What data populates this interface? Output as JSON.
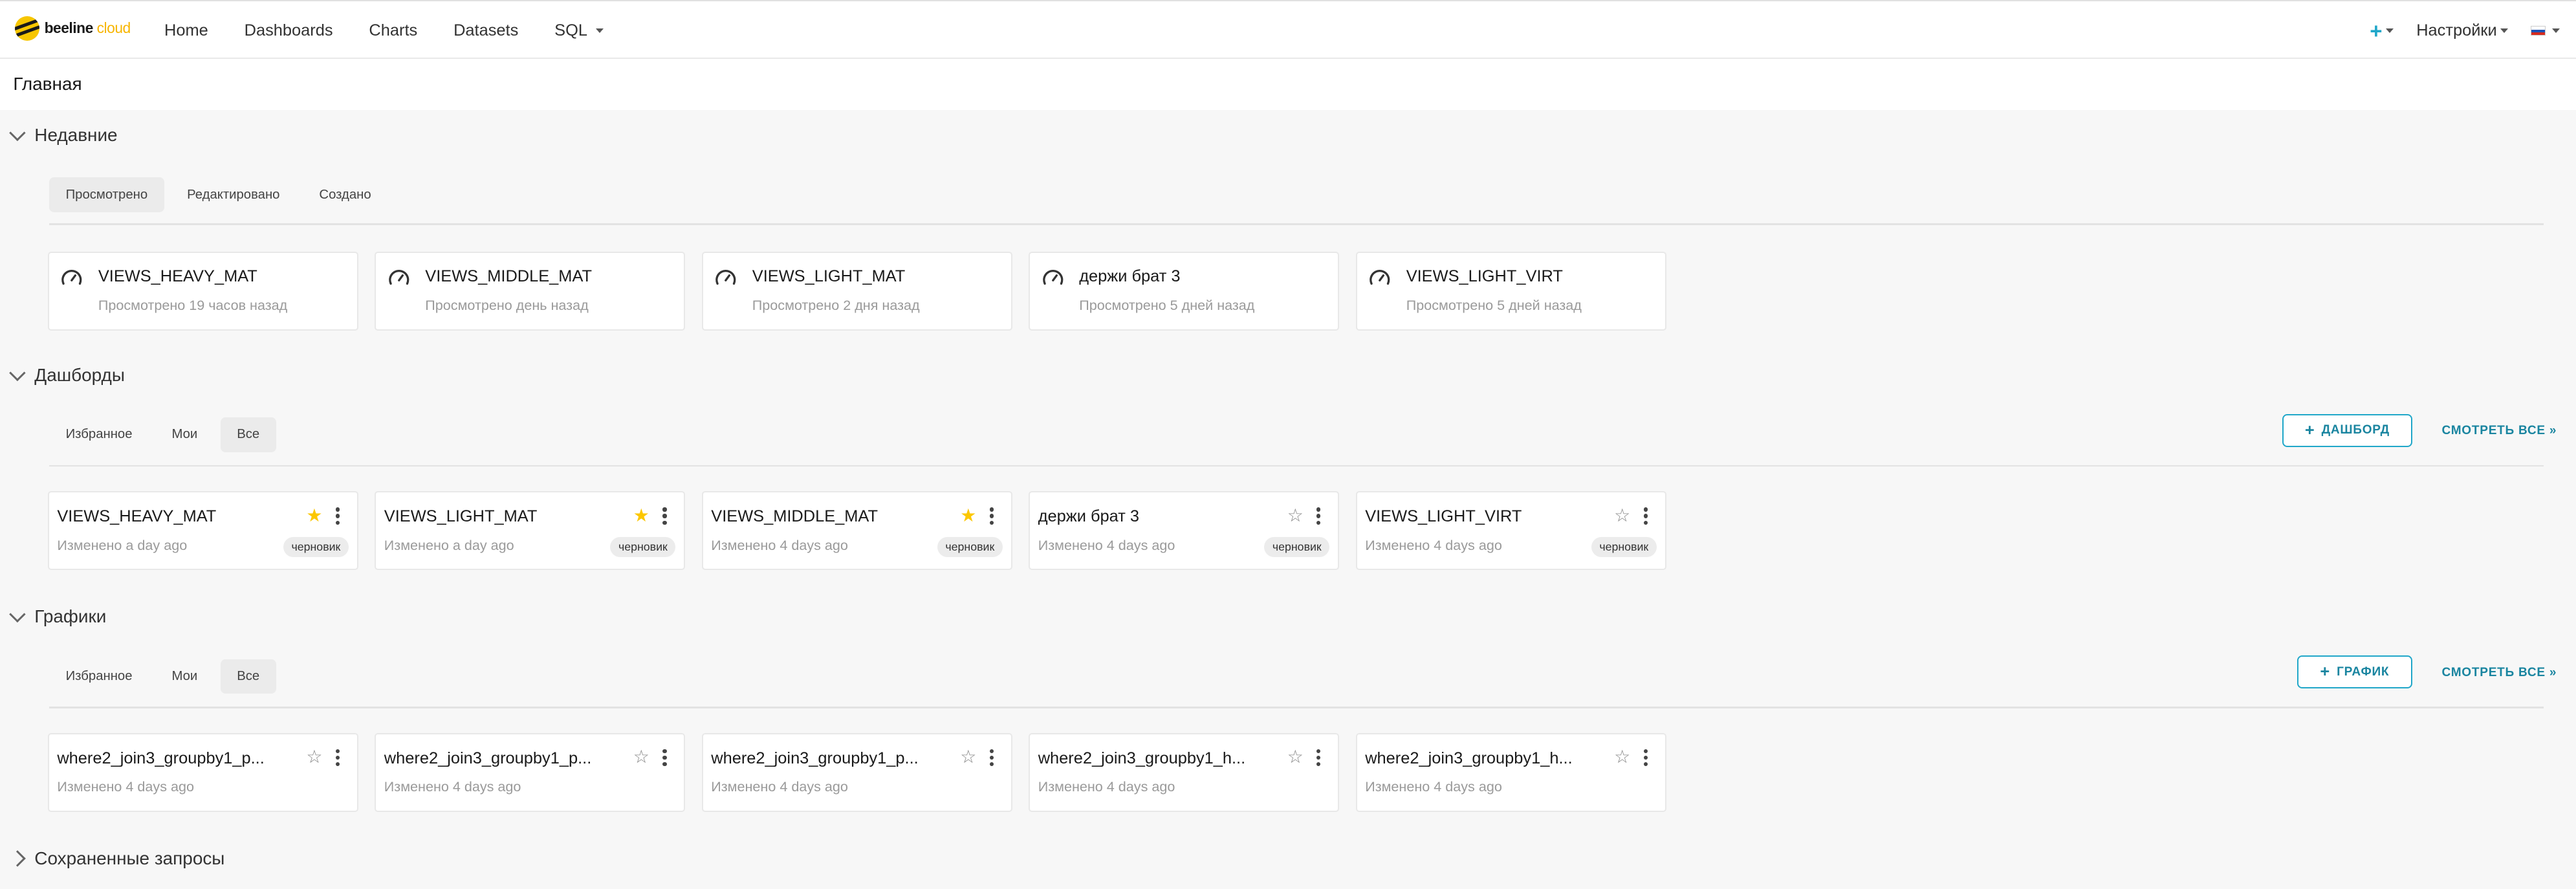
{
  "brand": {
    "name": "beeline",
    "suffix": "cloud"
  },
  "nav": {
    "items": [
      "Home",
      "Dashboards",
      "Charts",
      "Datasets",
      "SQL"
    ],
    "plus": "+",
    "settings": "Настройки"
  },
  "page": {
    "title": "Главная"
  },
  "recent": {
    "title": "Недавние",
    "tabs": [
      "Просмотрено",
      "Редактировано",
      "Создано"
    ],
    "items": [
      {
        "title": "VIEWS_HEAVY_MAT",
        "sub": "Просмотрено 19 часов назад"
      },
      {
        "title": "VIEWS_MIDDLE_MAT",
        "sub": "Просмотрено день назад"
      },
      {
        "title": "VIEWS_LIGHT_MAT",
        "sub": "Просмотрено 2 дня назад"
      },
      {
        "title": "держи брат 3",
        "sub": "Просмотрено 5 дней назад"
      },
      {
        "title": "VIEWS_LIGHT_VIRT",
        "sub": "Просмотрено 5 дней назад"
      }
    ]
  },
  "dashboards": {
    "title": "Дашборды",
    "tabs": [
      "Избранное",
      "Мои",
      "Все"
    ],
    "add_label": "ДАШБОРД",
    "see_all": "СМОТРЕТЬ ВСЕ »",
    "items": [
      {
        "title": "VIEWS_HEAVY_MAT",
        "sub": "Изменено a day ago",
        "badge": "черновик",
        "fav": true
      },
      {
        "title": "VIEWS_LIGHT_MAT",
        "sub": "Изменено a day ago",
        "badge": "черновик",
        "fav": true
      },
      {
        "title": "VIEWS_MIDDLE_MAT",
        "sub": "Изменено 4 days ago",
        "badge": "черновик",
        "fav": true
      },
      {
        "title": "держи брат 3",
        "sub": "Изменено 4 days ago",
        "badge": "черновик",
        "fav": false
      },
      {
        "title": "VIEWS_LIGHT_VIRT",
        "sub": "Изменено 4 days ago",
        "badge": "черновик",
        "fav": false
      }
    ]
  },
  "charts": {
    "title": "Графики",
    "tabs": [
      "Избранное",
      "Мои",
      "Все"
    ],
    "add_label": "ГРАФИК",
    "see_all": "СМОТРЕТЬ ВСЕ »",
    "items": [
      {
        "title": "where2_join3_groupby1_p...",
        "sub": "Изменено 4 days ago",
        "fav": false
      },
      {
        "title": "where2_join3_groupby1_p...",
        "sub": "Изменено 4 days ago",
        "fav": false
      },
      {
        "title": "where2_join3_groupby1_p...",
        "sub": "Изменено 4 days ago",
        "fav": false
      },
      {
        "title": "where2_join3_groupby1_h...",
        "sub": "Изменено 4 days ago",
        "fav": false
      },
      {
        "title": "where2_join3_groupby1_h...",
        "sub": "Изменено 4 days ago",
        "fav": false
      }
    ]
  },
  "saved_queries": {
    "title": "Сохраненные запросы"
  },
  "colors": {
    "accent": "#20a7c9",
    "star": "#fcc700",
    "brand_yellow": "#f7c600"
  }
}
